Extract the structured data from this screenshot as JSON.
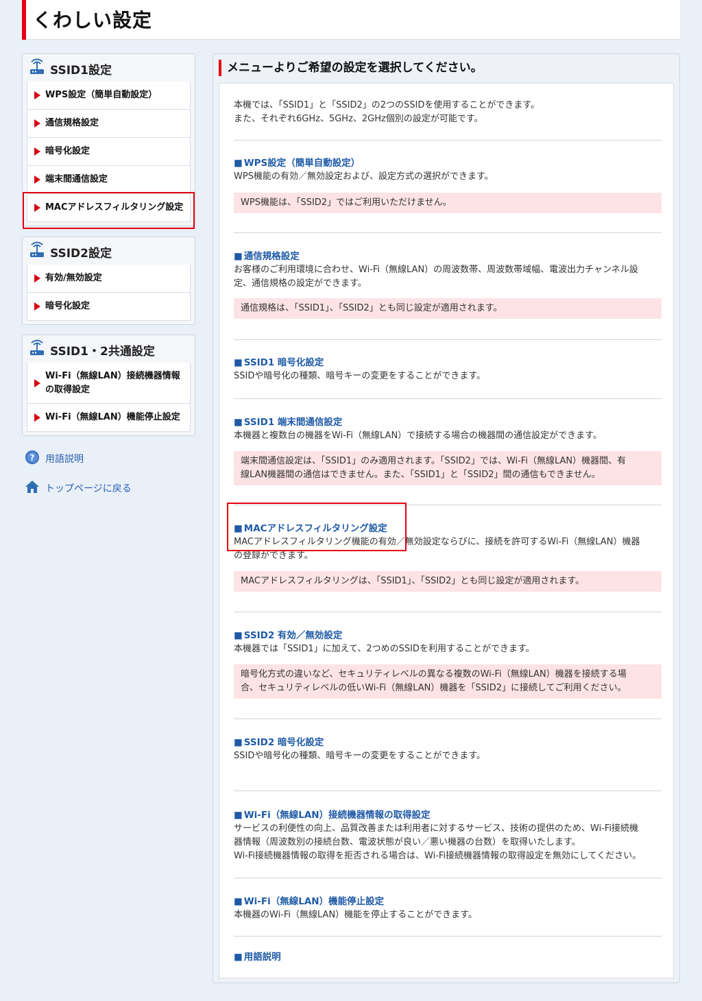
{
  "header": {
    "title": "くわしい設定"
  },
  "sidebar": {
    "ssid1": {
      "title": "SSID1設定",
      "items": [
        "WPS設定（簡単自動設定）",
        "通信規格設定",
        "暗号化設定",
        "端末間通信設定",
        "MACアドレスフィルタリング設定"
      ]
    },
    "ssid2": {
      "title": "SSID2設定",
      "items": [
        "有効/無効設定",
        "暗号化設定"
      ]
    },
    "common": {
      "title": "SSID1・2共通設定",
      "items": [
        "Wi-Fi（無線LAN）接続機器情報の取得設定",
        "Wi-Fi（無線LAN）機能停止設定"
      ]
    },
    "links": {
      "glossary": "用語説明",
      "top": "トップページに戻る"
    }
  },
  "main": {
    "heading": "メニューよりご希望の設定を選択してください。",
    "intro": [
      "本機では、「SSID1」と「SSID2」の2つのSSIDを使用することができます。",
      "また、それぞれ6GHz、5GHz、2GHz個別の設定が可能です。"
    ],
    "sections": [
      {
        "title": "WPS設定（簡単自動設定）",
        "desc": [
          "WPS機能の有効／無効設定および、設定方式の選択ができます。"
        ],
        "note": [
          "WPS機能は、「SSID2」ではご利用いただけません。"
        ]
      },
      {
        "title": "通信規格設定",
        "desc": [
          "お客様のご利用環境に合わせ、Wi-Fi（無線LAN）の周波数帯、周波数帯域幅、電波出力チャンネル設",
          "定、通信規格の設定ができます。"
        ],
        "note": [
          "通信規格は、「SSID1」、「SSID2」とも同じ設定が適用されます。"
        ]
      },
      {
        "title": "SSID1 暗号化設定",
        "desc": [
          "SSIDや暗号化の種類、暗号キーの変更をすることができます。"
        ]
      },
      {
        "title": "SSID1 端末間通信設定",
        "desc": [
          "本機器と複数台の機器をWi-Fi（無線LAN）で接続する場合の機器間の通信設定ができます。"
        ],
        "note": [
          "端末間通信設定は、「SSID1」のみ適用されます。「SSID2」では、Wi-Fi（無線LAN）機器間、有",
          "線LAN機器間の通信はできません。また、「SSID1」と「SSID2」間の通信もできません。"
        ]
      },
      {
        "title": "MACアドレスフィルタリング設定",
        "desc": [
          "MACアドレスフィルタリング機能の有効／無効設定ならびに、接続を許可するWi-Fi（無線LAN）機器",
          "の登録ができます。"
        ],
        "note": [
          "MACアドレスフィルタリングは、「SSID1」、「SSID2」とも同じ設定が適用されます。"
        ]
      },
      {
        "title": "SSID2 有効／無効設定",
        "desc": [
          "本機器では「SSID1」に加えて、2つめのSSIDを利用することができます。"
        ],
        "note": [
          "暗号化方式の違いなど、セキュリティレベルの異なる複数のWi-Fi（無線LAN）機器を接続する場",
          "合、セキュリティレベルの低いWi-Fi（無線LAN）機器を「SSID2」に接続してご利用ください。"
        ]
      },
      {
        "title": "SSID2 暗号化設定",
        "desc": [
          "SSIDや暗号化の種類、暗号キーの変更をすることができます。"
        ]
      },
      {
        "title": "Wi-Fi（無線LAN）接続機器情報の取得設定",
        "desc": [
          "サービスの利便性の向上、品質改善または利用者に対するサービス、技術の提供のため、Wi-Fi接続機",
          "器情報（周波数別の接続台数、電波状態が良い／悪い機器の台数）を取得いたします。",
          "Wi-Fi接続機器情報の取得を拒否される場合は、Wi-Fi接続機器情報の取得設定を無効にしてください。"
        ]
      },
      {
        "title": "Wi-Fi（無線LAN）機能停止設定",
        "desc": [
          "本機器のWi-Fi（無線LAN）機能を停止することができます。"
        ]
      },
      {
        "title": "用語説明",
        "desc": []
      }
    ]
  },
  "colors": {
    "accent": "#e60012",
    "link": "#1f5aa6",
    "note_bg": "#fde3e5"
  }
}
